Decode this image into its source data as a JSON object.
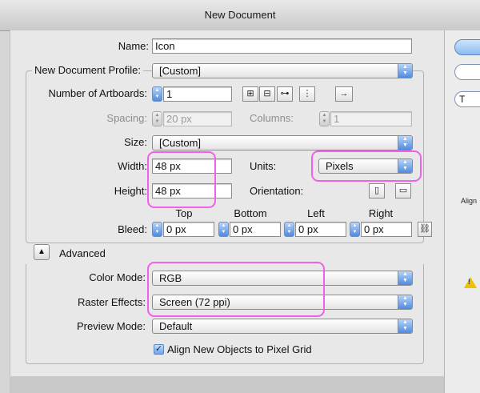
{
  "window": {
    "title": "New Document"
  },
  "name": {
    "label": "Name:",
    "value": "Icon"
  },
  "profile": {
    "label": "New Document Profile:",
    "value": "[Custom]"
  },
  "artboards": {
    "label": "Number of Artboards:",
    "value": "1"
  },
  "spacing": {
    "label": "Spacing:",
    "value": "20 px"
  },
  "columns": {
    "label": "Columns:",
    "value": "1"
  },
  "size": {
    "label": "Size:",
    "value": "[Custom]"
  },
  "width": {
    "label": "Width:",
    "value": "48 px"
  },
  "height": {
    "label": "Height:",
    "value": "48 px"
  },
  "units": {
    "label": "Units:",
    "value": "Pixels"
  },
  "orientation": {
    "label": "Orientation:"
  },
  "bleed": {
    "label": "Bleed:",
    "columns": [
      "Top",
      "Bottom",
      "Left",
      "Right"
    ],
    "values": [
      "0 px",
      "0 px",
      "0 px",
      "0 px"
    ]
  },
  "advanced": {
    "label": "Advanced"
  },
  "color_mode": {
    "label": "Color Mode:",
    "value": "RGB"
  },
  "raster_effects": {
    "label": "Raster Effects:",
    "value": "Screen (72 ppi)"
  },
  "preview_mode": {
    "label": "Preview Mode:",
    "value": "Default"
  },
  "align_checkbox": {
    "label": "Align New Objects to Pixel Grid",
    "checked": true
  },
  "side_panel": {
    "align_label": "Align"
  },
  "colors": {
    "highlight": "#f060e8",
    "stepper_blue": "#4f8be0"
  },
  "icons": {
    "arrangement": [
      "grid-by-row-icon",
      "grid-by-column-icon",
      "arrange-by-row-icon",
      "arrange-by-column-icon",
      "right-to-left-arrow-icon"
    ],
    "orientation": [
      "portrait-icon",
      "landscape-icon"
    ],
    "bleed_link": "chain-link-icon",
    "warning": "warning-icon"
  }
}
